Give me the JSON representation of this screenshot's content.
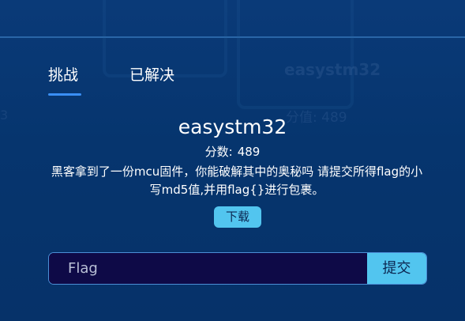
{
  "tabs": [
    {
      "label": "挑战",
      "active": true
    },
    {
      "label": "已解决",
      "active": false
    }
  ],
  "challenge": {
    "title": "easystm32",
    "score_label": "分数:",
    "score_value": "489",
    "description": "黑客拿到了一份mcu固件，你能破解其中的奥秘吗 请提交所得flag的小写md5值,并用flag{}进行包裹。",
    "download_label": "下载"
  },
  "submit_form": {
    "placeholder": "Flag",
    "value": "",
    "submit_label": "提交"
  },
  "background_ghost": {
    "title": "easystm32",
    "score": "分值: 489",
    "left_fragment": "3"
  },
  "colors": {
    "accent": "#3a8ff5",
    "button": "#52c5ef",
    "input_bg": "#0e0a47",
    "panel_bg": "#06336f"
  }
}
